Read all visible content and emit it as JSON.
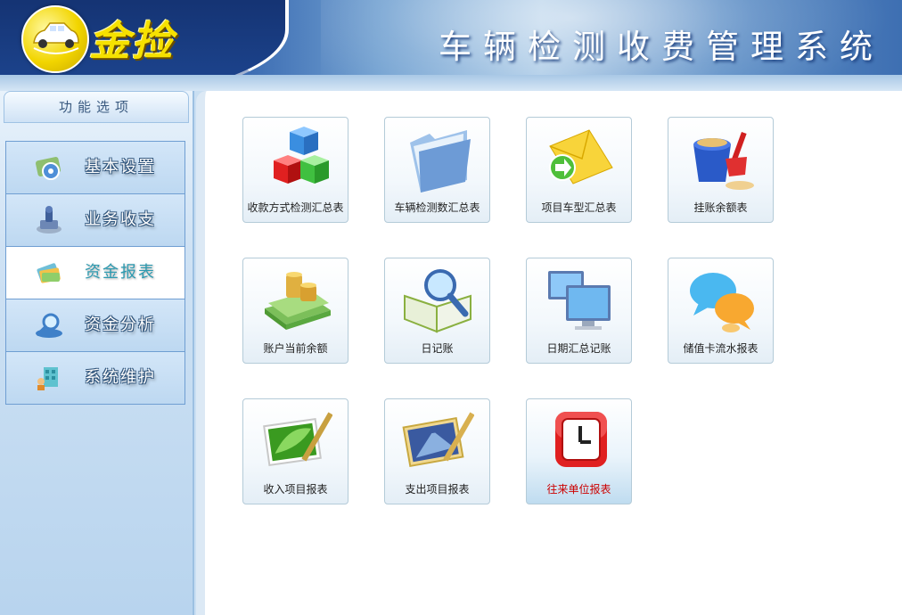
{
  "header": {
    "logo_text": "金捡",
    "app_title": "车辆检测收费管理系统"
  },
  "sidebar": {
    "title": "功能选项",
    "items": [
      {
        "label": "基本设置",
        "active": false
      },
      {
        "label": "业务收支",
        "active": false
      },
      {
        "label": "资金报表",
        "active": true
      },
      {
        "label": "资金分析",
        "active": false
      },
      {
        "label": "系统维护",
        "active": false
      }
    ]
  },
  "reports": {
    "row1": [
      {
        "label": "收款方式检测汇总表",
        "icon": "cubes-icon"
      },
      {
        "label": "车辆检测数汇总表",
        "icon": "folder-icon"
      },
      {
        "label": "项目车型汇总表",
        "icon": "envelope-arrow-icon"
      },
      {
        "label": "挂账余额表",
        "icon": "bucket-shovel-icon"
      }
    ],
    "row2": [
      {
        "label": "账户当前余额",
        "icon": "money-coins-icon"
      },
      {
        "label": "日记账",
        "icon": "book-magnifier-icon"
      },
      {
        "label": "日期汇总记账",
        "icon": "monitors-icon"
      },
      {
        "label": "储值卡流水报表",
        "icon": "chat-bubbles-icon"
      }
    ],
    "row3": [
      {
        "label": "收入项目报表",
        "icon": "leaf-picture-icon"
      },
      {
        "label": "支出项目报表",
        "icon": "road-picture-icon"
      },
      {
        "label": "往来单位报表",
        "icon": "clock-icon",
        "highlight_color": "#cc0000"
      }
    ]
  },
  "colors": {
    "header_dark": "#1b3f86",
    "accent": "#2d9ab0",
    "highlight_label": "#cc0000"
  }
}
